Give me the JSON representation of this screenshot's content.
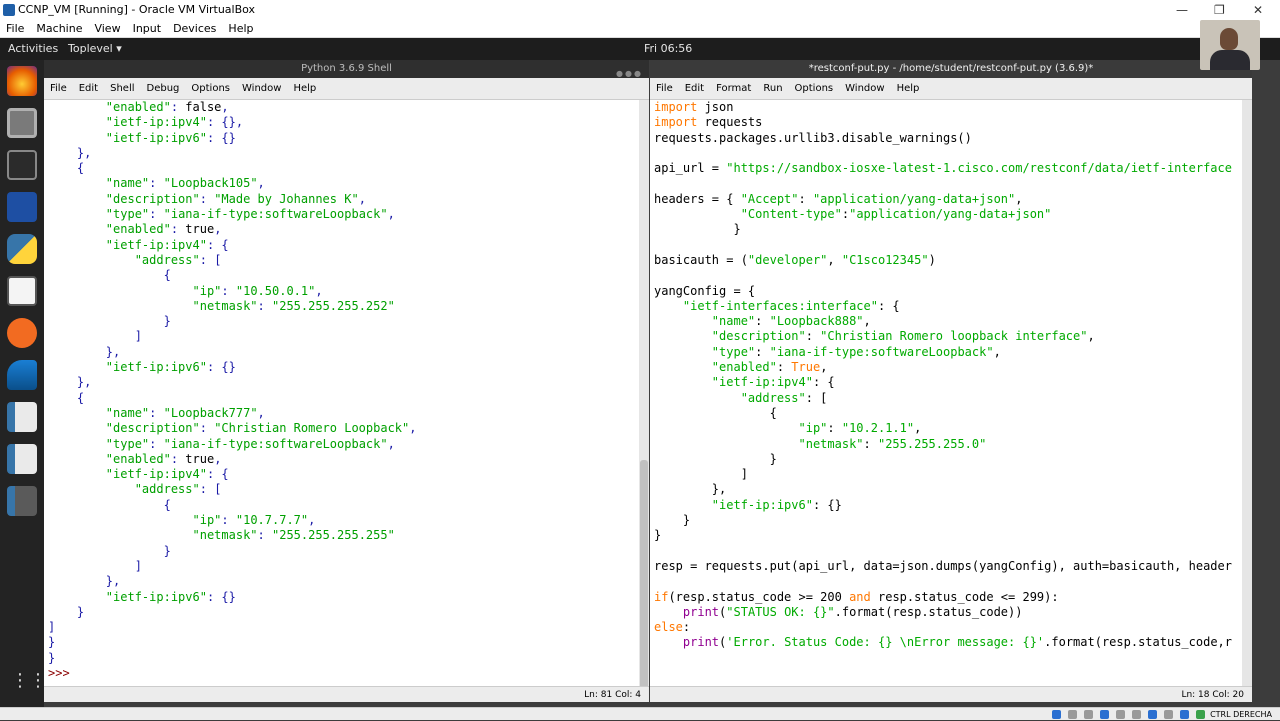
{
  "vbox": {
    "title": "CCNP_VM [Running] - Oracle VM VirtualBox",
    "menu": [
      "File",
      "Machine",
      "View",
      "Input",
      "Devices",
      "Help"
    ],
    "host_key": "CTRL DERECHA"
  },
  "gnome": {
    "activities": "Activities",
    "toplevel": "Toplevel ▾",
    "clock": "Fri 06:56"
  },
  "shell": {
    "title": "Python 3.6.9 Shell",
    "menu": [
      "File",
      "Edit",
      "Shell",
      "Debug",
      "Options",
      "Window",
      "Help"
    ],
    "status": "Ln: 81  Col: 4",
    "lines": [
      "        \"enabled\": false,",
      "        \"ietf-ip:ipv4\": {},",
      "        \"ietf-ip:ipv6\": {}",
      "    },",
      "    {",
      "        \"name\": \"Loopback105\",",
      "        \"description\": \"Made by Johannes K\",",
      "        \"type\": \"iana-if-type:softwareLoopback\",",
      "        \"enabled\": true,",
      "        \"ietf-ip:ipv4\": {",
      "            \"address\": [",
      "                {",
      "                    \"ip\": \"10.50.0.1\",",
      "                    \"netmask\": \"255.255.255.252\"",
      "                }",
      "            ]",
      "        },",
      "        \"ietf-ip:ipv6\": {}",
      "    },",
      "    {",
      "        \"name\": \"Loopback777\",",
      "        \"description\": \"Christian Romero Loopback\",",
      "        \"type\": \"iana-if-type:softwareLoopback\",",
      "        \"enabled\": true,",
      "        \"ietf-ip:ipv4\": {",
      "            \"address\": [",
      "                {",
      "                    \"ip\": \"10.7.7.7\",",
      "                    \"netmask\": \"255.255.255.255\"",
      "                }",
      "            ]",
      "        },",
      "        \"ietf-ip:ipv6\": {}",
      "    }",
      "]",
      "}",
      "}",
      ">>>"
    ]
  },
  "editor": {
    "title": "*restconf-put.py - /home/student/restconf-put.py (3.6.9)*",
    "menu": [
      "File",
      "Edit",
      "Format",
      "Run",
      "Options",
      "Window",
      "Help"
    ],
    "status": "Ln: 18  Col: 20",
    "lines": [
      "import json",
      "import requests",
      "requests.packages.urllib3.disable_warnings()",
      "",
      "api_url = \"https://sandbox-iosxe-latest-1.cisco.com/restconf/data/ietf-interface",
      "",
      "headers = { \"Accept\": \"application/yang-data+json\",",
      "            \"Content-type\":\"application/yang-data+json\"",
      "           }",
      "",
      "basicauth = (\"developer\", \"C1sco12345\")",
      "",
      "yangConfig = {",
      "    \"ietf-interfaces:interface\": {",
      "        \"name\": \"Loopback888\",",
      "        \"description\": \"Christian Romero loopback interface\",",
      "        \"type\": \"iana-if-type:softwareLoopback\",",
      "        \"enabled\": True,",
      "        \"ietf-ip:ipv4\": {",
      "            \"address\": [",
      "                {",
      "                    \"ip\": \"10.2.1.1\",",
      "                    \"netmask\": \"255.255.255.0\"",
      "                }",
      "            ]",
      "        },",
      "        \"ietf-ip:ipv6\": {}",
      "    }",
      "}",
      "",
      "resp = requests.put(api_url, data=json.dumps(yangConfig), auth=basicauth, header",
      "",
      "if(resp.status_code >= 200 and resp.status_code <= 299):",
      "    print(\"STATUS OK: {}\".format(resp.status_code))",
      "else:",
      "    print('Error. Status Code: {} \\nError message: {}'.format(resp.status_code,r"
    ]
  },
  "colors": {
    "keyword": "#ff7700",
    "string": "#00aa00",
    "builtin": "#900090",
    "json_string": "#00a000",
    "json_punct": "#1a1aa6"
  }
}
